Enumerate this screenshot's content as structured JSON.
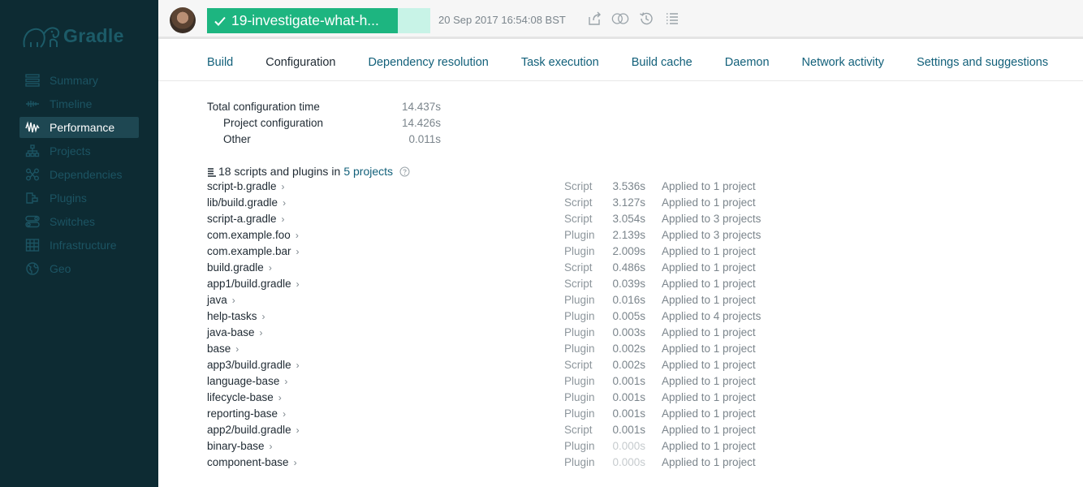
{
  "app": {
    "name": "Gradle"
  },
  "sidebar": {
    "items": [
      {
        "label": "Summary",
        "icon": "summary-icon",
        "active": false
      },
      {
        "label": "Timeline",
        "icon": "timeline-icon",
        "active": false
      },
      {
        "label": "Performance",
        "icon": "performance-icon",
        "active": true
      },
      {
        "label": "Projects",
        "icon": "projects-icon",
        "active": false
      },
      {
        "label": "Dependencies",
        "icon": "dependencies-icon",
        "active": false
      },
      {
        "label": "Plugins",
        "icon": "plugins-icon",
        "active": false
      },
      {
        "label": "Switches",
        "icon": "switches-icon",
        "active": false
      },
      {
        "label": "Infrastructure",
        "icon": "infrastructure-icon",
        "active": false
      },
      {
        "label": "Geo",
        "icon": "geo-icon",
        "active": false
      }
    ]
  },
  "header": {
    "build_name": "19-investigate-what-h...",
    "timestamp": "20 Sep 2017 16:54:08 BST",
    "tools": [
      "share-icon",
      "compare-icon",
      "history-icon",
      "list-icon"
    ]
  },
  "tabs": [
    {
      "label": "Build",
      "active": false
    },
    {
      "label": "Configuration",
      "active": true
    },
    {
      "label": "Dependency resolution",
      "active": false
    },
    {
      "label": "Task execution",
      "active": false
    },
    {
      "label": "Build cache",
      "active": false
    },
    {
      "label": "Daemon",
      "active": false
    },
    {
      "label": "Network activity",
      "active": false
    },
    {
      "label": "Settings and suggestions",
      "active": false
    }
  ],
  "summary": {
    "total": {
      "label": "Total configuration time",
      "value": "14.437s"
    },
    "project": {
      "label": "Project configuration",
      "value": "14.426s"
    },
    "other": {
      "label": "Other",
      "value": "0.011s"
    }
  },
  "scripts": {
    "heading": "18 scripts and plugins",
    "in_text": "in",
    "projects_link": "5 projects",
    "rows": [
      {
        "name": "script-b.gradle",
        "kind": "Script",
        "duration": "3.536s",
        "applied": "Applied to 1 project"
      },
      {
        "name": "lib/build.gradle",
        "kind": "Script",
        "duration": "3.127s",
        "applied": "Applied to 1 project"
      },
      {
        "name": "script-a.gradle",
        "kind": "Script",
        "duration": "3.054s",
        "applied": "Applied to 3 projects"
      },
      {
        "name": "com.example.foo",
        "kind": "Plugin",
        "duration": "2.139s",
        "applied": "Applied to 3 projects"
      },
      {
        "name": "com.example.bar",
        "kind": "Plugin",
        "duration": "2.009s",
        "applied": "Applied to 1 project"
      },
      {
        "name": "build.gradle",
        "kind": "Script",
        "duration": "0.486s",
        "applied": "Applied to 1 project"
      },
      {
        "name": "app1/build.gradle",
        "kind": "Script",
        "duration": "0.039s",
        "applied": "Applied to 1 project"
      },
      {
        "name": "java",
        "kind": "Plugin",
        "duration": "0.016s",
        "applied": "Applied to 1 project"
      },
      {
        "name": "help-tasks",
        "kind": "Plugin",
        "duration": "0.005s",
        "applied": "Applied to 4 projects"
      },
      {
        "name": "java-base",
        "kind": "Plugin",
        "duration": "0.003s",
        "applied": "Applied to 1 project"
      },
      {
        "name": "base",
        "kind": "Plugin",
        "duration": "0.002s",
        "applied": "Applied to 1 project"
      },
      {
        "name": "app3/build.gradle",
        "kind": "Script",
        "duration": "0.002s",
        "applied": "Applied to 1 project"
      },
      {
        "name": "language-base",
        "kind": "Plugin",
        "duration": "0.001s",
        "applied": "Applied to 1 project"
      },
      {
        "name": "lifecycle-base",
        "kind": "Plugin",
        "duration": "0.001s",
        "applied": "Applied to 1 project"
      },
      {
        "name": "reporting-base",
        "kind": "Plugin",
        "duration": "0.001s",
        "applied": "Applied to 1 project"
      },
      {
        "name": "app2/build.gradle",
        "kind": "Script",
        "duration": "0.001s",
        "applied": "Applied to 1 project"
      },
      {
        "name": "binary-base",
        "kind": "Plugin",
        "duration": "0.000s",
        "applied": "Applied to 1 project"
      },
      {
        "name": "component-base",
        "kind": "Plugin",
        "duration": "0.000s",
        "applied": "Applied to 1 project"
      }
    ]
  }
}
